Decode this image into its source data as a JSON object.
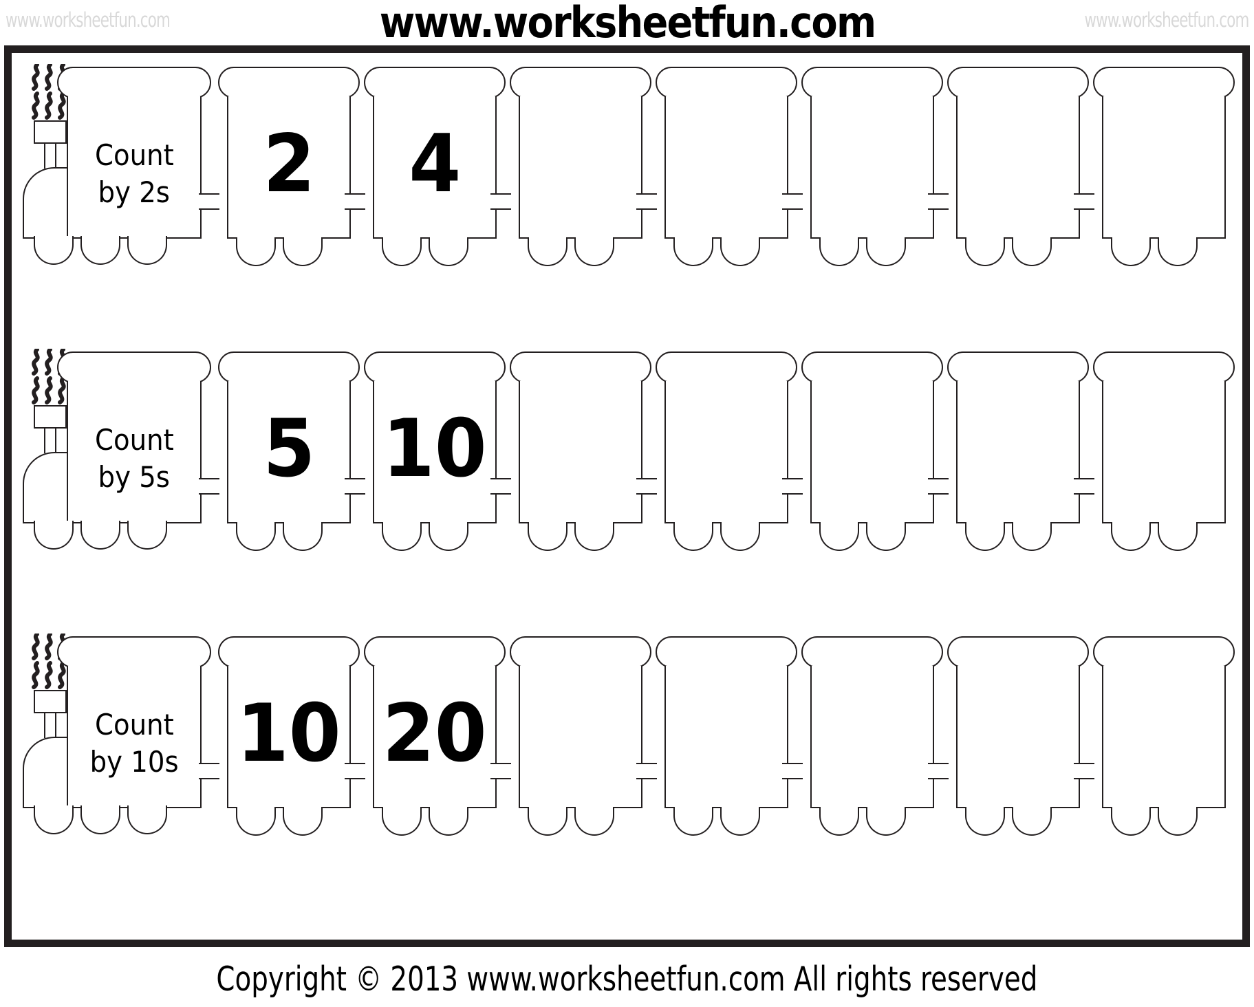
{
  "header": {
    "watermark_left": "www.worksheetfun.com",
    "watermark_center": "www.worksheetfun.com",
    "watermark_right": "www.worksheetfun.com"
  },
  "footer": {
    "copyright": "Copyright © 2013 www.worksheetfun.com All rights reserved"
  },
  "colors": {
    "ink": "#231f20",
    "paper": "#ffffff",
    "watermark_faded": "#d8d8d8"
  },
  "worksheet": {
    "cars_per_train": 7,
    "locomotive_wheels": 3,
    "car_wheels": 2,
    "rows": [
      {
        "id": "count-by-2s",
        "label_line1": "Count",
        "label_line2": "by 2s",
        "step": 2,
        "cars": [
          "2",
          "4",
          "",
          "",
          "",
          "",
          ""
        ]
      },
      {
        "id": "count-by-5s",
        "label_line1": "Count",
        "label_line2": "by 5s",
        "step": 5,
        "cars": [
          "5",
          "10",
          "",
          "",
          "",
          "",
          ""
        ]
      },
      {
        "id": "count-by-10s",
        "label_line1": "Count",
        "label_line2": "by 10s",
        "step": 10,
        "cars": [
          "10",
          "20",
          "",
          "",
          "",
          "",
          ""
        ]
      }
    ]
  }
}
